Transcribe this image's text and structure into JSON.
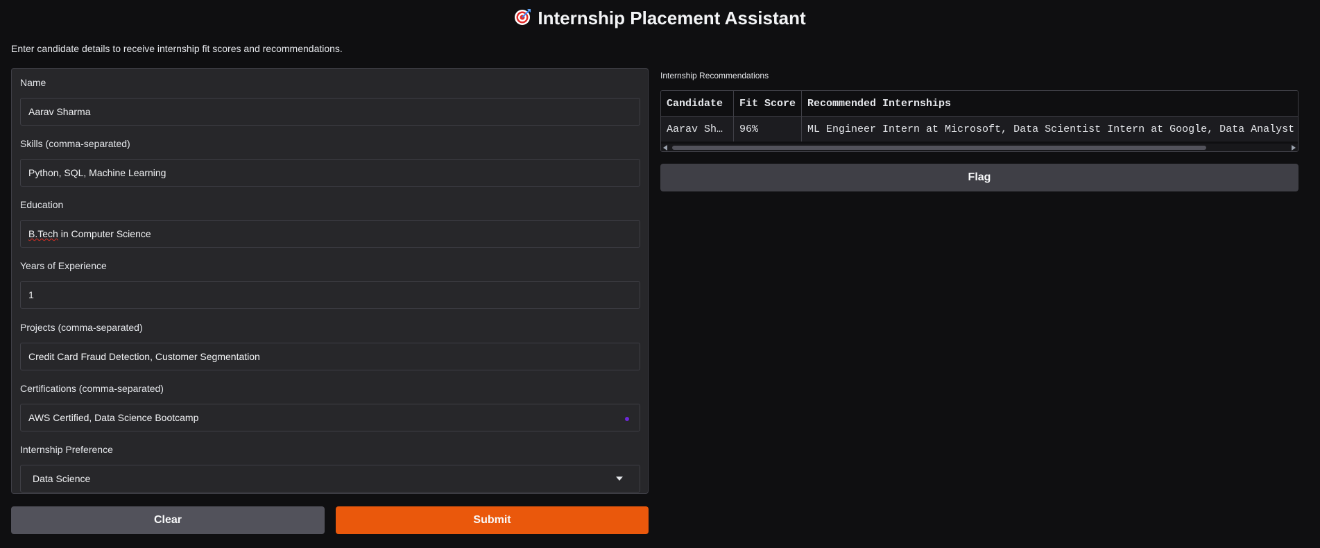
{
  "header": {
    "icon": "target-dart-icon",
    "title": "Internship Placement Assistant",
    "subtitle": "Enter candidate details to receive internship fit scores and recommendations."
  },
  "form": {
    "fields": [
      {
        "label": "Name",
        "value": "Aarav Sharma"
      },
      {
        "label": "Skills (comma-separated)",
        "value": "Python, SQL, Machine Learning"
      },
      {
        "label": "Education",
        "value_flagged": "B.Tech",
        "value_rest": " in Computer Science"
      },
      {
        "label": "Years of Experience",
        "value": "1"
      },
      {
        "label": "Projects (comma-separated)",
        "value": "Credit Card Fraud Detection, Customer Segmentation"
      },
      {
        "label": "Certifications (comma-separated)",
        "value": "AWS Certified, Data Science Bootcamp"
      },
      {
        "label": "Internship Preference",
        "value": "Data Science"
      }
    ],
    "clear_label": "Clear",
    "submit_label": "Submit"
  },
  "output": {
    "label": "Internship Recommendations",
    "columns": [
      "Candidate",
      "Fit Score",
      "Recommended Internships"
    ],
    "rows": [
      [
        "Aarav Sha…",
        "96%",
        "ML Engineer Intern at Microsoft, Data Scientist Intern at Google, Data Analyst Intern"
      ]
    ],
    "flag_label": "Flag"
  },
  "colors": {
    "background": "#0f0f11",
    "panel": "#27272a",
    "submit": "#ea580c",
    "clear": "#52525b",
    "flag": "#3f3f46"
  }
}
